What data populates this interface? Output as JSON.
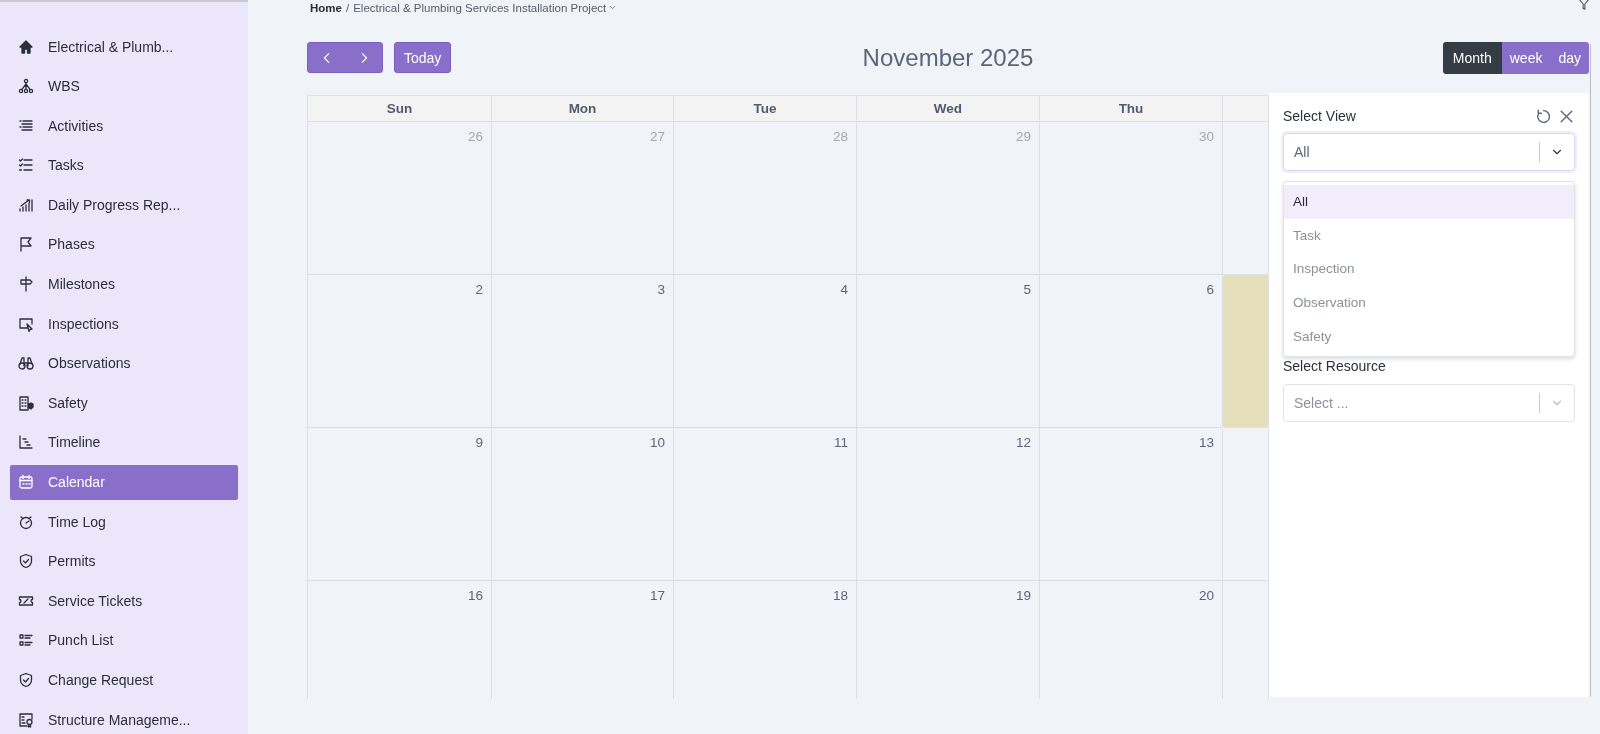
{
  "breadcrumb": {
    "items": [
      "Home",
      "Electrical & Plumbing Services Installation Project"
    ],
    "separator": "/"
  },
  "sidebar": {
    "items": [
      {
        "label": "Electrical & Plumb...",
        "selected": false
      },
      {
        "label": "WBS",
        "selected": false
      },
      {
        "label": "Activities",
        "selected": false
      },
      {
        "label": "Tasks",
        "selected": false
      },
      {
        "label": "Daily Progress Rep...",
        "selected": false
      },
      {
        "label": "Phases",
        "selected": false
      },
      {
        "label": "Milestones",
        "selected": false
      },
      {
        "label": "Inspections",
        "selected": false
      },
      {
        "label": "Observations",
        "selected": false
      },
      {
        "label": "Safety",
        "selected": false
      },
      {
        "label": "Timeline",
        "selected": false
      },
      {
        "label": "Calendar",
        "selected": true
      },
      {
        "label": "Time Log",
        "selected": false
      },
      {
        "label": "Permits",
        "selected": false
      },
      {
        "label": "Service Tickets",
        "selected": false
      },
      {
        "label": "Punch List",
        "selected": false
      },
      {
        "label": "Change Request",
        "selected": false
      },
      {
        "label": "Structure Manageme...",
        "selected": false
      }
    ]
  },
  "toolbar": {
    "today_button": "Today",
    "title": "November 2025",
    "views": [
      {
        "label": "Month",
        "selected": true
      },
      {
        "label": "week",
        "selected": false
      },
      {
        "label": "day",
        "selected": false
      }
    ]
  },
  "calendar": {
    "weekdays": [
      "Sun",
      "Mon",
      "Tue",
      "Wed",
      "Thu"
    ],
    "weeks": [
      {
        "days": [
          {
            "label": "26",
            "other_month": true
          },
          {
            "label": "27",
            "other_month": true
          },
          {
            "label": "28",
            "other_month": true
          },
          {
            "label": "29",
            "other_month": true
          },
          {
            "label": "30",
            "other_month": true
          },
          {
            "today": false
          }
        ]
      },
      {
        "days": [
          {
            "label": "2",
            "other_month": false
          },
          {
            "label": "3",
            "other_month": false
          },
          {
            "label": "4",
            "other_month": false
          },
          {
            "label": "5",
            "other_month": false
          },
          {
            "label": "6",
            "other_month": false
          },
          {
            "today": true
          }
        ]
      },
      {
        "days": [
          {
            "label": "9",
            "other_month": false
          },
          {
            "label": "10",
            "other_month": false
          },
          {
            "label": "11",
            "other_month": false
          },
          {
            "label": "12",
            "other_month": false
          },
          {
            "label": "13",
            "other_month": false
          },
          {
            "today": false
          }
        ]
      },
      {
        "days": [
          {
            "label": "16",
            "other_month": false
          },
          {
            "label": "17",
            "other_month": false
          },
          {
            "label": "18",
            "other_month": false
          },
          {
            "label": "19",
            "other_month": false
          },
          {
            "label": "20",
            "other_month": false
          },
          {
            "today": false
          }
        ]
      }
    ]
  },
  "filter_panel": {
    "title": "Select View",
    "view_select": {
      "value": "All",
      "expanded": true,
      "options": [
        {
          "label": "All",
          "selected": true
        },
        {
          "label": "Task",
          "selected": false
        },
        {
          "label": "Inspection",
          "selected": false
        },
        {
          "label": "Observation",
          "selected": false
        },
        {
          "label": "Safety",
          "selected": false
        }
      ]
    },
    "resource_label": "Select Resource",
    "resource_select": {
      "placeholder": "Select ..."
    }
  }
}
